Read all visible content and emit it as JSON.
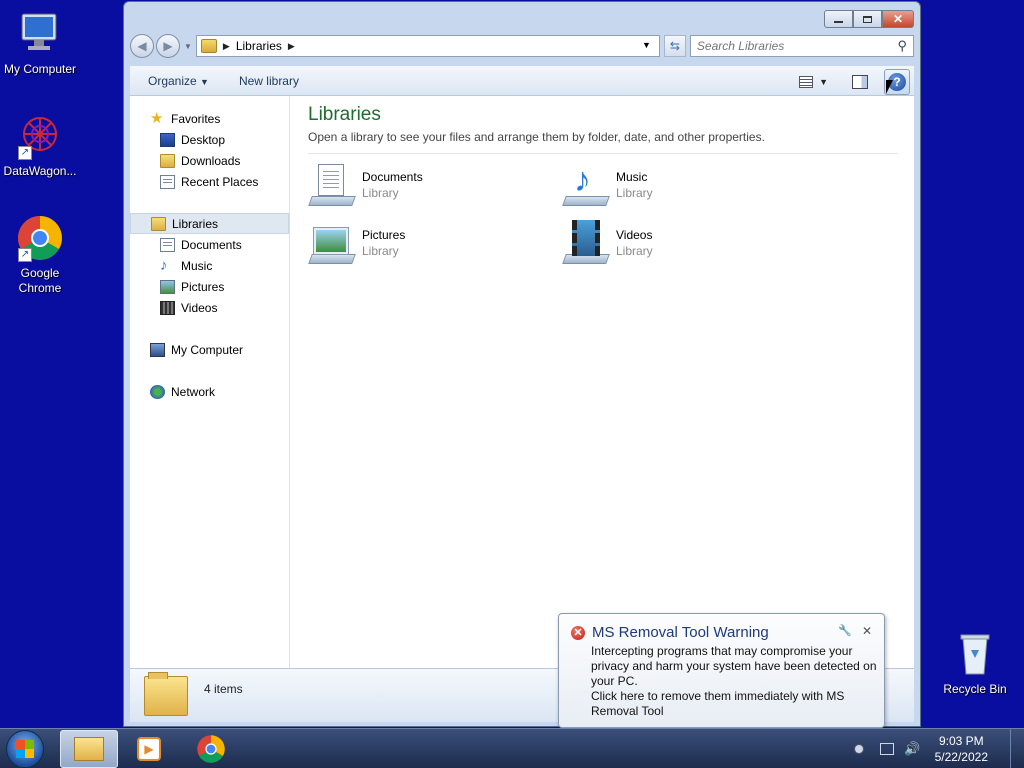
{
  "desktop": {
    "icons": [
      {
        "label": "My Computer",
        "icon": "computer-icon"
      },
      {
        "label": "DataWagon...",
        "icon": "datawagon-icon"
      },
      {
        "label": "Google Chrome",
        "icon": "chrome-icon"
      },
      {
        "label": "Recycle Bin",
        "icon": "recycle-bin-icon"
      }
    ]
  },
  "window": {
    "address": {
      "crumb": "Libraries"
    },
    "search": {
      "placeholder": "Search Libraries"
    },
    "toolbar": {
      "organize": "Organize",
      "new_library": "New library"
    },
    "nav": {
      "favorites": "Favorites",
      "favorites_items": [
        "Desktop",
        "Downloads",
        "Recent Places"
      ],
      "libraries": "Libraries",
      "libraries_items": [
        "Documents",
        "Music",
        "Pictures",
        "Videos"
      ],
      "computer": "My Computer",
      "network": "Network"
    },
    "content": {
      "title": "Libraries",
      "subtitle": "Open a library to see your files and arrange them by folder, date, and other properties.",
      "items": [
        {
          "name": "Documents",
          "type": "Library"
        },
        {
          "name": "Music",
          "type": "Library"
        },
        {
          "name": "Pictures",
          "type": "Library"
        },
        {
          "name": "Videos",
          "type": "Library"
        }
      ]
    },
    "details": {
      "count": "4 items"
    }
  },
  "balloon": {
    "title": "MS Removal Tool Warning",
    "line1": "Intercepting programs that may compromise your privacy and harm your system have been detected on your PC.",
    "line2": "Click here to remove them immediately with MS Removal Tool"
  },
  "taskbar": {
    "time": "9:03 PM",
    "date": "5/22/2022"
  },
  "colors": {
    "desktop": "#0a0ea0",
    "library_title": "#1e6c2f",
    "balloon_title": "#1e3a78"
  }
}
